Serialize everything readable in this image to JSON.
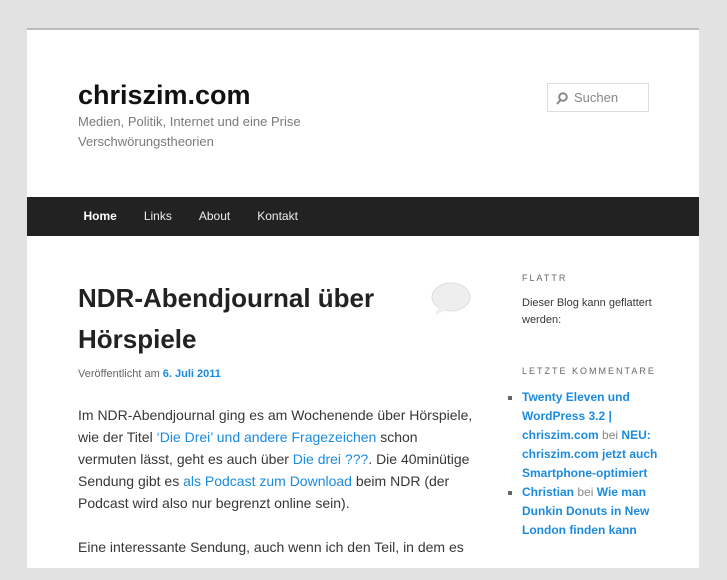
{
  "site": {
    "title": "chriszim.com",
    "description": "Medien, Politik, Internet und eine Prise Verschwörungstheorien"
  },
  "search": {
    "placeholder": "Suchen",
    "icon": "search-icon"
  },
  "nav": [
    "Home",
    "Links",
    "About",
    "Kontakt"
  ],
  "post": {
    "title": "NDR-Abendjournal über Hörspiele",
    "meta_prefix": "Veröffentlicht am",
    "date": "6. Juli 2011",
    "p1": [
      "Im NDR-Abendjournal ging es am Wochenende über Hörspiele, wie der Titel ",
      "‘Die Drei’ und andere Fragezeichen",
      " schon vermuten lässt, geht es auch über ",
      "Die drei ???",
      ". Die 40minütige Sendung gibt es ",
      "als Podcast zum Download",
      " beim NDR (der Podcast wird also nur begrenzt online sein)."
    ],
    "p2": "Eine interessante Sendung, auch wenn ich den Teil, in dem es"
  },
  "sidebar": {
    "flattr_title": "FLATTR",
    "flattr_text": "Dieser Blog kann geflattert werden:",
    "comments_title": "LETZTE KOMMENTARE",
    "comments": [
      {
        "author": "Twenty Eleven und WordPress 3.2 | chriszim.com",
        "on": "bei",
        "post": "NEU: chriszim.com jetzt auch Smartphone-optimiert"
      },
      {
        "author": "Christian",
        "on": "bei",
        "post": "Wie man Dunkin Donuts in New London finden kann"
      }
    ]
  }
}
